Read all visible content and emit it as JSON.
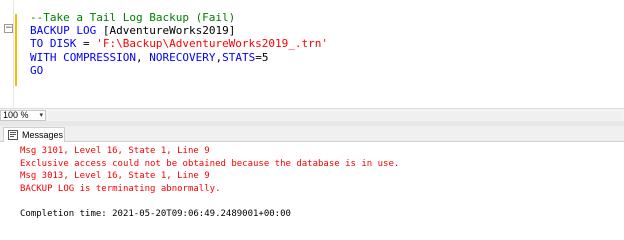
{
  "editor": {
    "collapse_glyph": "−",
    "lines": [
      [
        {
          "t": "--Take a Tail Log Backup (Fail)",
          "c": "cmt"
        }
      ],
      [
        {
          "t": "BACKUP LOG ",
          "c": "kw"
        },
        {
          "t": "[AdventureWorks2019]",
          "c": "plain"
        }
      ],
      [
        {
          "t": "TO DISK ",
          "c": "kw"
        },
        {
          "t": "= ",
          "c": "plain"
        },
        {
          "t": "'F:\\Backup\\AdventureWorks2019_.trn'",
          "c": "str"
        }
      ],
      [
        {
          "t": "WITH COMPRESSION",
          "c": "kw"
        },
        {
          "t": ", ",
          "c": "plain"
        },
        {
          "t": "NORECOVERY",
          "c": "kw"
        },
        {
          "t": ",",
          "c": "plain"
        },
        {
          "t": "STATS",
          "c": "kw"
        },
        {
          "t": "=5",
          "c": "plain"
        }
      ],
      [
        {
          "t": "GO",
          "c": "kw"
        }
      ]
    ]
  },
  "zoom": {
    "value": "100 %",
    "arrow": "▾"
  },
  "results": {
    "tab_label": "Messages",
    "messages": [
      {
        "t": "Msg 3101, Level 16, State 1, Line 9",
        "c": "err"
      },
      {
        "t": "Exclusive access could not be obtained because the database is in use.",
        "c": "err"
      },
      {
        "t": "Msg 3013, Level 16, State 1, Line 9",
        "c": "err"
      },
      {
        "t": "BACKUP LOG is terminating abnormally.",
        "c": "err"
      },
      {
        "t": "",
        "c": "ok"
      },
      {
        "t": "Completion time: 2021-05-20T09:06:49.2489001+00:00",
        "c": "ok"
      }
    ]
  },
  "colors": {
    "keyword": "#0000ff",
    "string": "#ff0000",
    "comment": "#008000",
    "error": "#ff0000",
    "change_bar": "#f0c000"
  },
  "icons": {
    "messages_tab": "messages-icon",
    "collapse": "collapse-icon"
  }
}
